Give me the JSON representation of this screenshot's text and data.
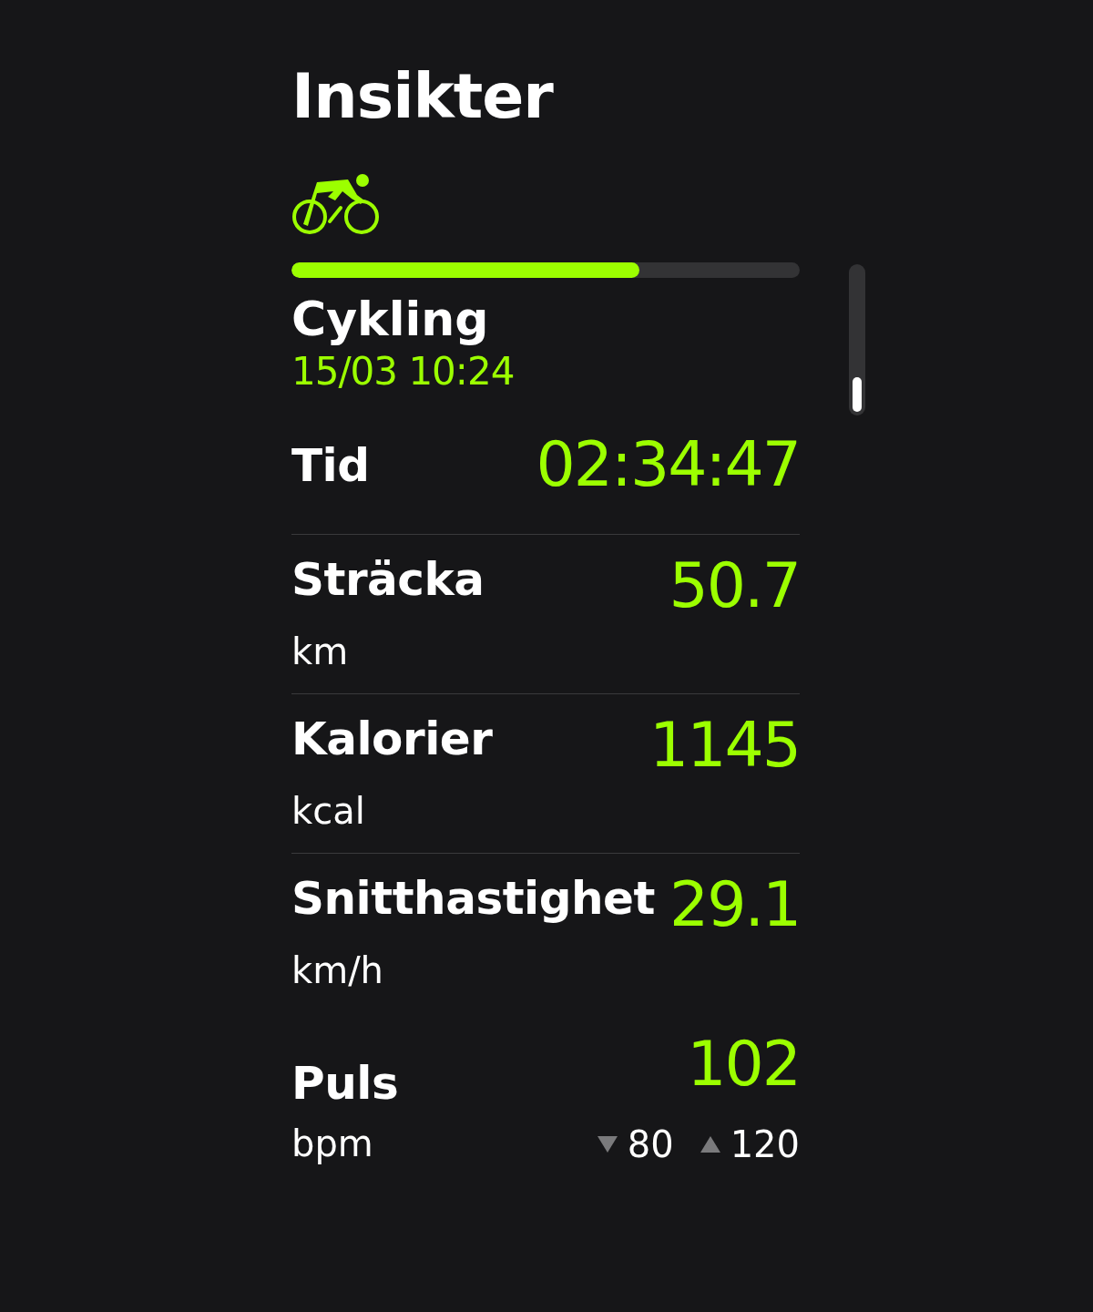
{
  "title": "Insikter",
  "activity": {
    "name": "Cykling",
    "datetime": "15/03 10:24",
    "level": 0.685
  },
  "metrics": [
    {
      "label": "Tid",
      "value": "02:34:47",
      "divider": true
    },
    {
      "label": "Sträcka",
      "unit": "km",
      "value": "50.7",
      "divider": true
    },
    {
      "label": "Kalorier",
      "unit": "kcal",
      "value": "1145",
      "divider": true
    },
    {
      "label": "Snitthastighet",
      "unit": "km/h",
      "value": "29.1",
      "divider": false
    },
    {
      "label": "Puls",
      "unit": "bpm",
      "value": "102",
      "min": "80",
      "max": "120",
      "divider": false
    }
  ]
}
